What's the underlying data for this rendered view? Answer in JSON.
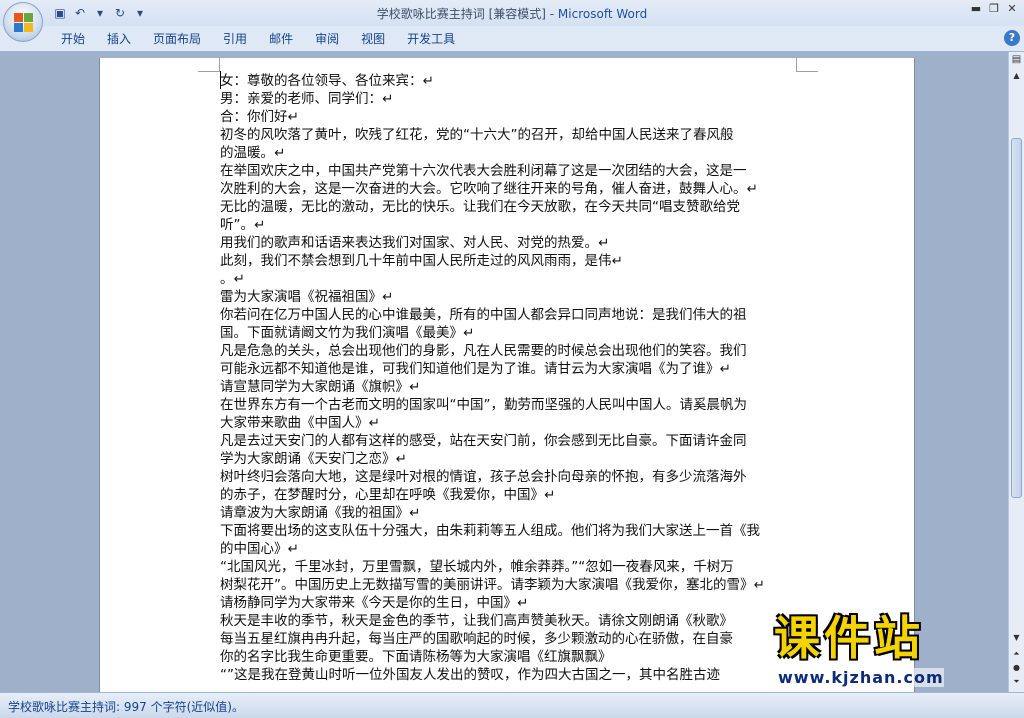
{
  "window": {
    "title_doc": "学校歌咏比赛主持词 [兼容模式] - ",
    "title_app": "Microsoft Word"
  },
  "ribbon": {
    "tabs": [
      "开始",
      "插入",
      "页面布局",
      "引用",
      "邮件",
      "审阅",
      "视图",
      "开发工具"
    ]
  },
  "document": {
    "lines": [
      "    女：尊敬的各位领导、各位来宾：↵",
      "    男：亲爱的老师、同学们：↵",
      "    合：你们好↵",
      "    初冬的风吹落了黄叶，吹残了红花，党的“十六大”的召开，却给中国人民送来了春风般",
      "的温暖。↵",
      "    在举国欢庆之中，中国共产党第十六次代表大会胜利闭幕了这是一次团结的大会，这是一",
      "次胜利的大会，这是一次奋进的大会。它吹响了继往开来的号角，催人奋进，鼓舞人心。↵",
      "    无比的温暖，无比的激动，无比的快乐。让我们在今天放歌，在今天共同“唱支赞歌给党",
      "听”。↵",
      "    用我们的歌声和话语来表达我们对国家、对人民、对党的热爱。↵",
      "    此刻，我们不禁会想到几十年前中国人民所走过的风风雨雨，是伟↵",
      "。↵",
      "雷为大家演唱《祝福祖国》↵",
      "    你若问在亿万中国人民的心中谁最美，所有的中国人都会异口同声地说：是我们伟大的祖",
      "国。下面就请阚文竹为我们演唱《最美》↵",
      "    凡是危急的关头，总会出现他们的身影，凡在人民需要的时候总会出现他们的笑容。我们",
      "可能永远都不知道他是谁，可我们知道他们是为了谁。请甘云为大家演唱《为了谁》↵",
      "    请宣慧同学为大家朗诵《旗帜》↵",
      "    在世界东方有一个古老而文明的国家叫“中国”，勤劳而坚强的人民叫中国人。请奚晨帆为",
      "大家带来歌曲《中国人》↵",
      "    凡是去过天安门的人都有这样的感受，站在天安门前，你会感到无比自豪。下面请许金同",
      "学为大家朗诵《天安门之恋》↵",
      "    树叶终归会落向大地，这是绿叶对根的情谊，孩子总会扑向母亲的怀抱，有多少流落海外",
      "的赤子，在梦醒时分，心里却在呼唤《我爱你，中国》↵",
      "    请章波为大家朗诵《我的祖国》↵",
      "    下面将要出场的这支队伍十分强大，由朱莉莉等五人组成。他们将为我们大家送上一首《我",
      "的中国心》↵",
      "    “北国风光，千里冰封，万里雪飘，望长城内外，帷余莽莽。”“忽如一夜春风来，千树万",
      "树梨花开”。中国历史上无数描写雪的美丽讲评。请李颖为大家演唱《我爱你，塞北的雪》↵",
      "    请杨静同学为大家带来《今天是你的生日，中国》↵",
      "    秋天是丰收的季节，秋天是金色的季节，让我们高声赞美秋天。请徐文刚朗诵《秋歌》",
      "    每当五星红旗冉冉升起，每当庄严的国歌响起的时候，多少颗激动的心在骄傲，在自豪",
      "你的名字比我生命更重要。下面请陈杨等为大家演唱《红旗飘飘》",
      "    “”这是我在登黄山时听一位外国友人发出的赞叹，作为四大古国之一，其中名胜古迹"
    ]
  },
  "statusbar": {
    "text": "学校歌咏比赛主持词: 997 个字符(近似值)。"
  },
  "watermark": {
    "text": "课件站",
    "url": "www.kjzhan.com"
  },
  "colors": {
    "title_app": "#1f4f9c",
    "ribbon_bg": "#dfe9f5",
    "workspace_bg": "#9fb0cb",
    "watermark_fill": "#f3d400",
    "watermark_url": "#0d2b77"
  }
}
